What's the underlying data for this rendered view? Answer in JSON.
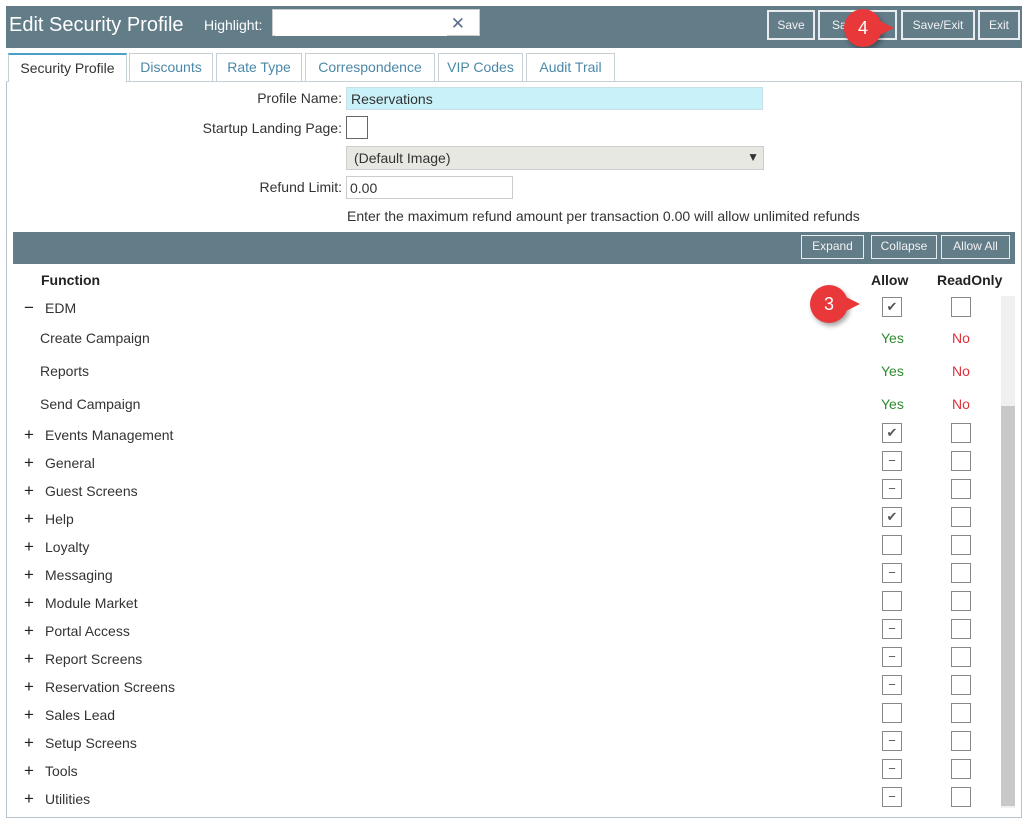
{
  "window": {
    "title": "Edit Security Profile"
  },
  "highlight": {
    "label": "Highlight:",
    "value": "",
    "clear_icon": "close-icon"
  },
  "toolbar": {
    "save": "Save",
    "save_new": "Sa",
    "save_exit": "Save/Exit",
    "exit": "Exit"
  },
  "annotations": {
    "step4": "4",
    "step3": "3"
  },
  "tabs": [
    "Security Profile",
    "Discounts",
    "Rate Type",
    "Correspondence",
    "VIP Codes",
    "Audit Trail"
  ],
  "form": {
    "profile_name_label": "Profile Name:",
    "profile_name_value": "Reservations",
    "startup_label": "Startup Landing Page:",
    "image_select": "(Default Image)",
    "refund_label": "Refund Limit:",
    "refund_value": "0.00",
    "refund_hint": "Enter the maximum refund amount per transaction 0.00 will allow unlimited refunds"
  },
  "grid_buttons": {
    "expand": "Expand",
    "collapse": "Collapse",
    "allow_all": "Allow All"
  },
  "columns": {
    "function": "Function",
    "allow": "Allow",
    "readonly": "ReadOnly"
  },
  "edm": {
    "expander": "−",
    "label": "EDM",
    "allow": "✔",
    "readonly": "",
    "children": [
      {
        "label": "Create Campaign",
        "allow": "Yes",
        "readonly": "No"
      },
      {
        "label": "Reports",
        "allow": "Yes",
        "readonly": "No"
      },
      {
        "label": "Send Campaign",
        "allow": "Yes",
        "readonly": "No"
      }
    ]
  },
  "functions": [
    {
      "expander": "+",
      "label": "Events Management",
      "allow": "✔",
      "readonly": ""
    },
    {
      "expander": "+",
      "label": "General",
      "allow": "−",
      "readonly": ""
    },
    {
      "expander": "+",
      "label": "Guest Screens",
      "allow": "−",
      "readonly": ""
    },
    {
      "expander": "+",
      "label": "Help",
      "allow": "✔",
      "readonly": ""
    },
    {
      "expander": "+",
      "label": "Loyalty",
      "allow": "",
      "readonly": ""
    },
    {
      "expander": "+",
      "label": "Messaging",
      "allow": "−",
      "readonly": ""
    },
    {
      "expander": "+",
      "label": "Module Market",
      "allow": "",
      "readonly": ""
    },
    {
      "expander": "+",
      "label": "Portal Access",
      "allow": "−",
      "readonly": ""
    },
    {
      "expander": "+",
      "label": "Report Screens",
      "allow": "−",
      "readonly": ""
    },
    {
      "expander": "+",
      "label": "Reservation Screens",
      "allow": "−",
      "readonly": ""
    },
    {
      "expander": "+",
      "label": "Sales Lead",
      "allow": "",
      "readonly": ""
    },
    {
      "expander": "+",
      "label": "Setup Screens",
      "allow": "−",
      "readonly": ""
    },
    {
      "expander": "+",
      "label": "Tools",
      "allow": "−",
      "readonly": ""
    },
    {
      "expander": "+",
      "label": "Utilities",
      "allow": "−",
      "readonly": ""
    }
  ]
}
